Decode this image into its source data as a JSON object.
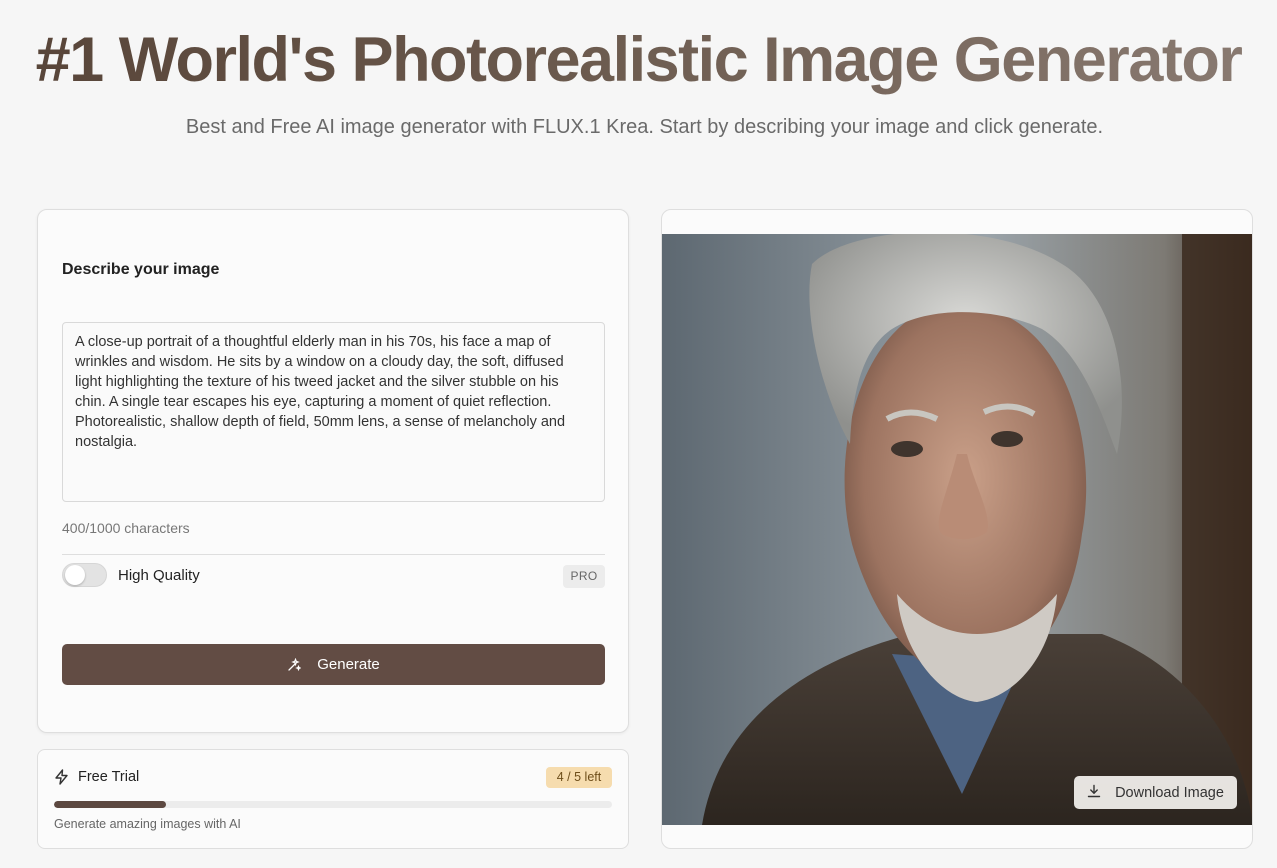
{
  "hero": {
    "title": "#1 World's Photorealistic Image Generator",
    "subtitle": "Best and Free AI image generator with FLUX.1 Krea. Start by describing your image and click generate."
  },
  "form": {
    "describe_label": "Describe your image",
    "prompt_value": "A close-up portrait of a thoughtful elderly man in his 70s, his face a map of wrinkles and wisdom. He sits by a window on a cloudy day, the soft, diffused light highlighting the texture of his tweed jacket and the silver stubble on his chin. A single tear escapes his eye, capturing a moment of quiet reflection. Photorealistic, shallow depth of field, 50mm lens, a sense of melancholy and nostalgia.",
    "char_count": "400/1000 characters",
    "high_quality_label": "High Quality",
    "high_quality_enabled": false,
    "pro_badge": "PRO",
    "generate_label": "Generate"
  },
  "trial": {
    "label": "Free Trial",
    "badge": "4 / 5 left",
    "progress_fraction": 0.2,
    "caption": "Generate amazing images with AI"
  },
  "preview": {
    "download_label": "Download Image"
  },
  "colors": {
    "accent": "#624c44",
    "badge_bg": "#f6dcae",
    "page_bg": "#f6f6f6"
  }
}
